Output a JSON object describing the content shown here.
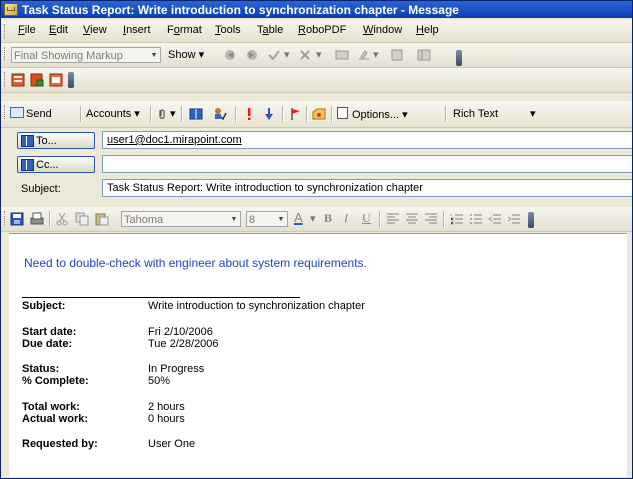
{
  "window": {
    "title": "Task Status Report: Write introduction to synchronization chapter - Message"
  },
  "menu": {
    "items": [
      {
        "pre": "",
        "acc": "F",
        "post": "ile"
      },
      {
        "pre": "",
        "acc": "E",
        "post": "dit"
      },
      {
        "pre": "",
        "acc": "V",
        "post": "iew"
      },
      {
        "pre": "",
        "acc": "I",
        "post": "nsert"
      },
      {
        "pre": "F",
        "acc": "o",
        "post": "rmat"
      },
      {
        "pre": "",
        "acc": "T",
        "post": "ools"
      },
      {
        "pre": "T",
        "acc": "a",
        "post": "ble"
      },
      {
        "pre": "",
        "acc": "R",
        "post": "oboPDF"
      },
      {
        "pre": "",
        "acc": "W",
        "post": "indow"
      },
      {
        "pre": "",
        "acc": "H",
        "post": "elp"
      }
    ]
  },
  "reviewing": {
    "markup_select": "Final Showing Markup",
    "show_label": "Show"
  },
  "send_toolbar": {
    "send_label": "Send",
    "accounts_label": "Accounts",
    "options_label": "Options...",
    "format_select": "Rich Text"
  },
  "header": {
    "to_button": "To...",
    "to_value": "user1@doc1.mirapoint.com",
    "cc_button": "Cc...",
    "cc_value": "",
    "subject_label": "Subject:",
    "subject_value": "Task Status Report: Write introduction to synchronization chapter"
  },
  "formatting": {
    "font": "Tahoma",
    "size": "8"
  },
  "message": {
    "intro": "Need to double-check with engineer about system requirements.",
    "subject_label": "Subject:",
    "subject_value": "Write introduction to synchronization chapter",
    "start_label": "Start date:",
    "start_value": "Fri 2/10/2006",
    "due_label": "Due date:",
    "due_value": "Tue 2/28/2006",
    "status_label": "Status:",
    "status_value": "In Progress",
    "complete_label": "% Complete:",
    "complete_value": "50%",
    "total_label": "Total work:",
    "total_value": "2 hours",
    "actual_label": "Actual work:",
    "actual_value": "0 hours",
    "requested_label": "Requested by:",
    "requested_value": "User One"
  },
  "colors": {
    "title_bar": "#0a3fb0",
    "intro_text": "#1f3fd2"
  }
}
